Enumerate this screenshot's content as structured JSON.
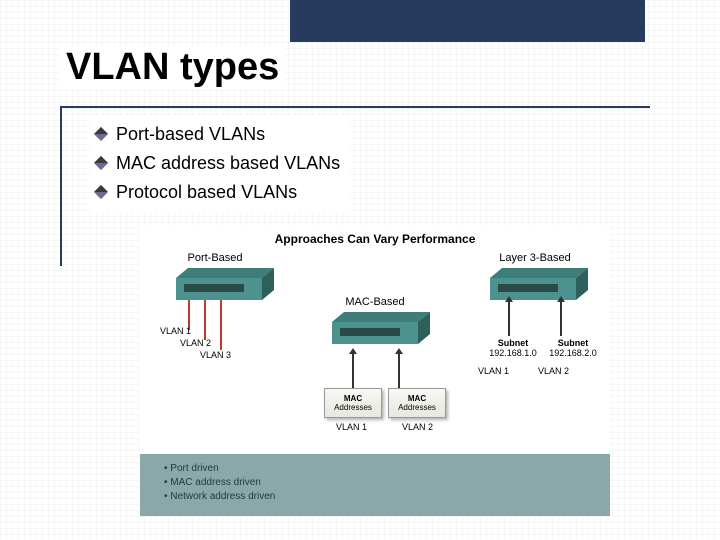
{
  "title": "VLAN types",
  "bullets": {
    "b1": "Port-based VLANs",
    "b2": "MAC address based VLANs",
    "b3": "Protocol based VLANs"
  },
  "figure": {
    "title": "Approaches Can Vary Performance",
    "columns": {
      "left": "Port-Based",
      "mid": "MAC-Based",
      "right": "Layer 3-Based"
    },
    "left": {
      "vlan1": "VLAN 1",
      "vlan2": "VLAN 2",
      "vlan3": "VLAN 3"
    },
    "mid": {
      "mac_label1": "MAC",
      "mac_label2": "Addresses",
      "vlan1": "VLAN 1",
      "vlan2": "VLAN 2"
    },
    "right": {
      "subnet_word": "Subnet",
      "s1": "192.168.1.0",
      "s2": "192.168.2.0",
      "vlan1": "VLAN 1",
      "vlan2": "VLAN 2"
    }
  },
  "footer": {
    "f1": "Port driven",
    "f2": "MAC address driven",
    "f3": "Network address driven"
  },
  "colors": {
    "accent": "#273b5f",
    "switch_top": "#3e7d7a",
    "switch_side": "#2f5f5c",
    "band": "#8aa8a7"
  }
}
